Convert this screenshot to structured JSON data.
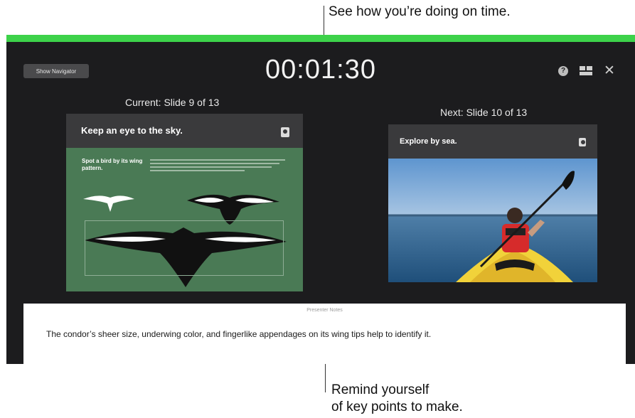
{
  "callouts": {
    "top": "See how you’re doing on time.",
    "bottom_line1": "Remind yourself",
    "bottom_line2": "of key points to make."
  },
  "presenter": {
    "show_navigator_label": "Show Navigator",
    "clock": "00:01:30",
    "help_glyph": "?",
    "close_glyph": "✕",
    "icons": [
      "help-icon",
      "layout-icon",
      "close-icon"
    ],
    "colors": {
      "timer_bar": "#3dd24a",
      "background": "#1c1c1e"
    }
  },
  "current_slide": {
    "label": "Current: Slide 9 of 13",
    "title": "Keep an eye to the sky.",
    "subtitle": "Spot a bird by its wing pattern."
  },
  "next_slide": {
    "label": "Next: Slide 10 of 13",
    "title": "Explore by sea."
  },
  "notes": {
    "label": "Presenter Notes",
    "text": "The condor’s sheer size, underwing color, and fingerlike appendages on its wing tips help to identify it."
  }
}
